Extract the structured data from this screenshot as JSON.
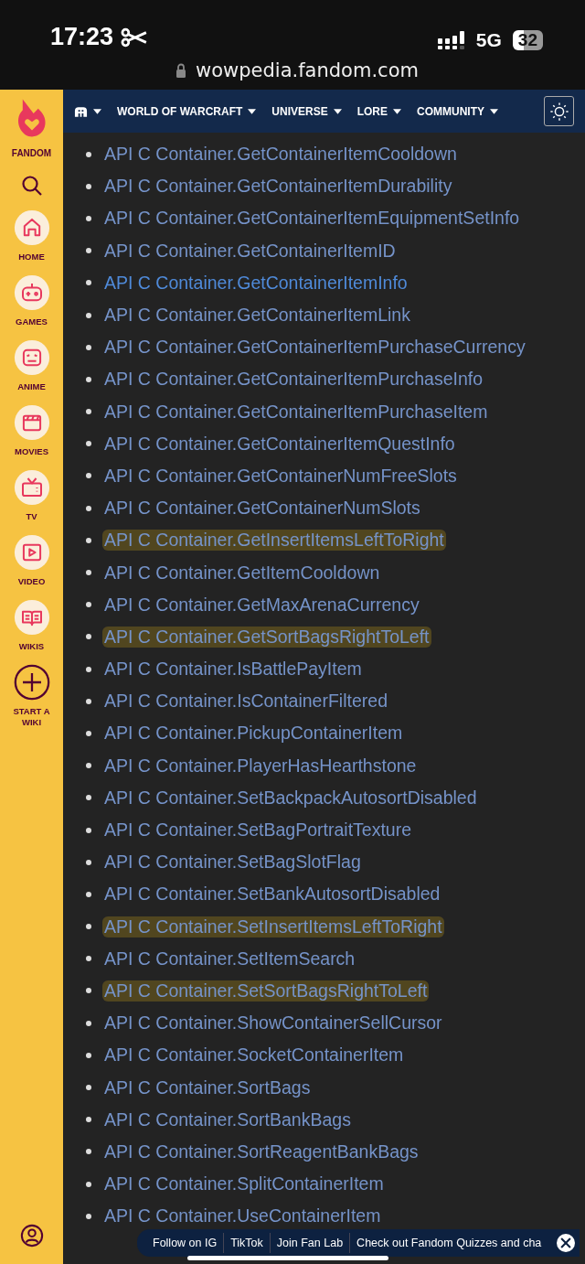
{
  "status_bar": {
    "time": "17:23",
    "network": "5G",
    "battery": "32"
  },
  "address_bar": {
    "url": "wowpedia.fandom.com"
  },
  "sidebar": {
    "logo": "FANDOM",
    "items": [
      {
        "label": "HOME",
        "kind": "home"
      },
      {
        "label": "GAMES",
        "kind": "games"
      },
      {
        "label": "ANIME",
        "kind": "anime"
      },
      {
        "label": "MOVIES",
        "kind": "movies"
      },
      {
        "label": "TV",
        "kind": "tv"
      },
      {
        "label": "VIDEO",
        "kind": "video"
      },
      {
        "label": "WIKIS",
        "kind": "wikis"
      },
      {
        "label": "START A WIKI",
        "kind": "start"
      }
    ]
  },
  "nav": {
    "items": [
      {
        "label": "WORLD OF WARCRAFT"
      },
      {
        "label": "UNIVERSE"
      },
      {
        "label": "LORE"
      },
      {
        "label": "COMMUNITY"
      }
    ]
  },
  "links": [
    {
      "text": "API C Container.GetContainerItemCooldown",
      "highlighted": false,
      "visited": false
    },
    {
      "text": "API C Container.GetContainerItemDurability",
      "highlighted": false,
      "visited": false
    },
    {
      "text": "API C Container.GetContainerItemEquipmentSetInfo",
      "highlighted": false,
      "visited": false
    },
    {
      "text": "API C Container.GetContainerItemID",
      "highlighted": false,
      "visited": false
    },
    {
      "text": "API C Container.GetContainerItemInfo",
      "highlighted": false,
      "visited": true
    },
    {
      "text": "API C Container.GetContainerItemLink",
      "highlighted": false,
      "visited": false
    },
    {
      "text": "API C Container.GetContainerItemPurchaseCurrency",
      "highlighted": false,
      "visited": false
    },
    {
      "text": "API C Container.GetContainerItemPurchaseInfo",
      "highlighted": false,
      "visited": false
    },
    {
      "text": "API C Container.GetContainerItemPurchaseItem",
      "highlighted": false,
      "visited": false
    },
    {
      "text": "API C Container.GetContainerItemQuestInfo",
      "highlighted": false,
      "visited": false
    },
    {
      "text": "API C Container.GetContainerNumFreeSlots",
      "highlighted": false,
      "visited": false
    },
    {
      "text": "API C Container.GetContainerNumSlots",
      "highlighted": false,
      "visited": false
    },
    {
      "text": "API C Container.GetInsertItemsLeftToRight",
      "highlighted": true,
      "visited": false
    },
    {
      "text": "API C Container.GetItemCooldown",
      "highlighted": false,
      "visited": false
    },
    {
      "text": "API C Container.GetMaxArenaCurrency",
      "highlighted": false,
      "visited": false
    },
    {
      "text": "API C Container.GetSortBagsRightToLeft",
      "highlighted": true,
      "visited": false
    },
    {
      "text": "API C Container.IsBattlePayItem",
      "highlighted": false,
      "visited": false
    },
    {
      "text": "API C Container.IsContainerFiltered",
      "highlighted": false,
      "visited": false
    },
    {
      "text": "API C Container.PickupContainerItem",
      "highlighted": false,
      "visited": false
    },
    {
      "text": "API C Container.PlayerHasHearthstone",
      "highlighted": false,
      "visited": false
    },
    {
      "text": "API C Container.SetBackpackAutosortDisabled",
      "highlighted": false,
      "visited": false
    },
    {
      "text": "API C Container.SetBagPortraitTexture",
      "highlighted": false,
      "visited": false
    },
    {
      "text": "API C Container.SetBagSlotFlag",
      "highlighted": false,
      "visited": false
    },
    {
      "text": "API C Container.SetBankAutosortDisabled",
      "highlighted": false,
      "visited": false
    },
    {
      "text": "API C Container.SetInsertItemsLeftToRight",
      "highlighted": true,
      "visited": false
    },
    {
      "text": "API C Container.SetItemSearch",
      "highlighted": false,
      "visited": false
    },
    {
      "text": "API C Container.SetSortBagsRightToLeft",
      "highlighted": true,
      "visited": false
    },
    {
      "text": "API C Container.ShowContainerSellCursor",
      "highlighted": false,
      "visited": false
    },
    {
      "text": "API C Container.SocketContainerItem",
      "highlighted": false,
      "visited": false
    },
    {
      "text": "API C Container.SortBags",
      "highlighted": false,
      "visited": false
    },
    {
      "text": "API C Container.SortBankBags",
      "highlighted": false,
      "visited": false
    },
    {
      "text": "API C Container.SortReagentBankBags",
      "highlighted": false,
      "visited": false
    },
    {
      "text": "API C Container.SplitContainerItem",
      "highlighted": false,
      "visited": false
    },
    {
      "text": "API C Container.UseContainerItem",
      "highlighted": false,
      "visited": false
    }
  ],
  "banner": {
    "items": [
      "Follow on IG",
      "TikTok",
      "Join Fan Lab",
      "Check out Fandom Quizzes and cha"
    ]
  }
}
